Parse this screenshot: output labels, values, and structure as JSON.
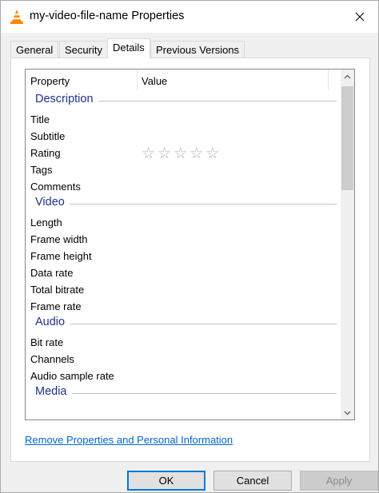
{
  "window": {
    "title": "my-video-file-name Properties"
  },
  "tabs": [
    {
      "label": "General",
      "active": false
    },
    {
      "label": "Security",
      "active": false
    },
    {
      "label": "Details",
      "active": true
    },
    {
      "label": "Previous Versions",
      "active": false
    }
  ],
  "details": {
    "columns": {
      "property": "Property",
      "value": "Value"
    },
    "groups": [
      {
        "label": "Description",
        "rows": [
          {
            "property": "Title",
            "value": ""
          },
          {
            "property": "Subtitle",
            "value": ""
          },
          {
            "property": "Rating",
            "value": "☆☆☆☆☆",
            "rating_stars": 0,
            "rating_max": 5
          },
          {
            "property": "Tags",
            "value": ""
          },
          {
            "property": "Comments",
            "value": ""
          }
        ]
      },
      {
        "label": "Video",
        "rows": [
          {
            "property": "Length",
            "value": ""
          },
          {
            "property": "Frame width",
            "value": ""
          },
          {
            "property": "Frame height",
            "value": ""
          },
          {
            "property": "Data rate",
            "value": ""
          },
          {
            "property": "Total bitrate",
            "value": ""
          },
          {
            "property": "Frame rate",
            "value": ""
          }
        ]
      },
      {
        "label": "Audio",
        "rows": [
          {
            "property": "Bit rate",
            "value": ""
          },
          {
            "property": "Channels",
            "value": ""
          },
          {
            "property": "Audio sample rate",
            "value": ""
          }
        ]
      },
      {
        "label": "Media",
        "rows": []
      }
    ]
  },
  "links": {
    "remove": "Remove Properties and Personal Information"
  },
  "buttons": {
    "ok": "OK",
    "cancel": "Cancel",
    "apply": "Apply"
  },
  "colors": {
    "accent": "#0078d7",
    "group_header": "#1e3287",
    "link": "#0066cc",
    "vlc_orange": "#ff8800"
  }
}
